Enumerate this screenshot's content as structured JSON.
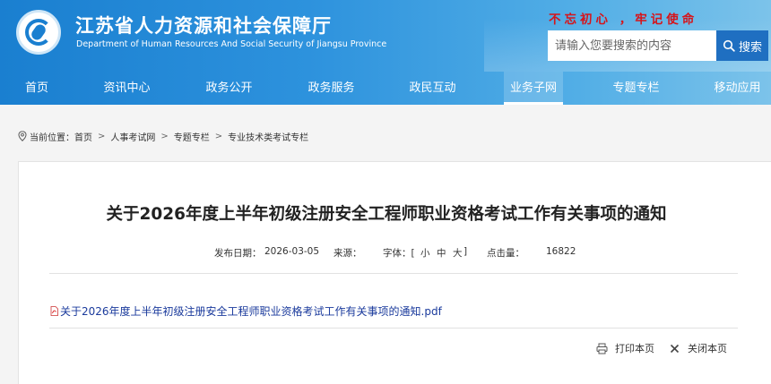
{
  "header": {
    "title": "江苏省人力资源和社会保障厅",
    "subtitle": "Department of Human Resources And Social Security of Jiangsu Province",
    "slogan": "不忘初心 ，牢记使命",
    "colors": {
      "primary": "#1a7fd0",
      "slogan": "#d6141a",
      "search_button": "#1f6fc1"
    }
  },
  "search": {
    "placeholder": "请输入您要搜索的内容",
    "button_label": "搜索",
    "icon": "search-icon"
  },
  "nav": {
    "items": [
      {
        "label": "首页"
      },
      {
        "label": "资讯中心"
      },
      {
        "label": "政务公开"
      },
      {
        "label": "政务服务"
      },
      {
        "label": "政民互动"
      },
      {
        "label": "业务子网",
        "active": true
      },
      {
        "label": "专题专栏"
      },
      {
        "label": "移动应用"
      }
    ]
  },
  "breadcrumb": {
    "prefix": "当前位置：",
    "items": [
      "首页",
      "人事考试网",
      "专题专栏",
      "专业技术类考试专栏"
    ],
    "separator": ">",
    "icon": "location-pin-icon"
  },
  "article": {
    "title": "关于2026年度上半年初级注册安全工程师职业资格考试工作有关事项的通知",
    "publish_label": "发布日期：",
    "publish_date": "2026-03-05",
    "source_label": "来源：",
    "font_label": "字体：[",
    "font_small": "小",
    "font_medium": "中",
    "font_large": "大",
    "font_close": "]",
    "views_label": "点击量：",
    "views": "16822",
    "attachment": "关于2026年度上半年初级注册安全工程师职业资格考试工作有关事项的通知.pdf",
    "print_label": "打印本页",
    "close_label": "关闭本页"
  }
}
